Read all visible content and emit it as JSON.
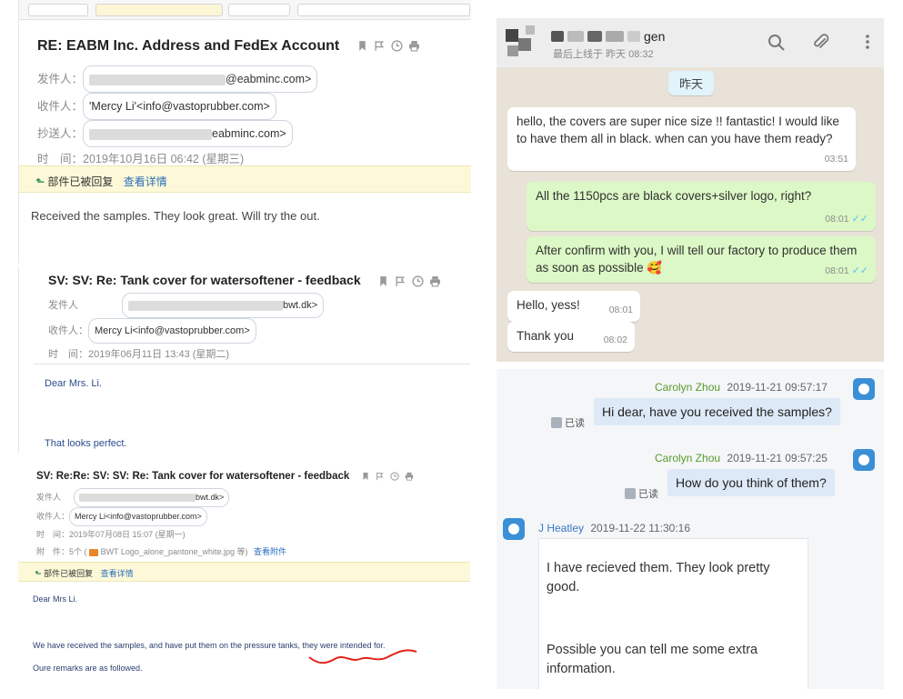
{
  "mail1": {
    "subject": "RE: EABM Inc. Address and FedEx Account",
    "from_label": "发件人：",
    "from_value": "@eabminc.com>",
    "to_label": "收件人：",
    "to_value": "'Mercy Li'<info@vastoprubber.com>",
    "cc_label": "抄送人：",
    "cc_value": "eabminc.com>",
    "time_label": "时　间：",
    "time_value": "2019年10月16日 06:42 (星期三)",
    "replied_text": "部件已被回复",
    "details_link": "查看详情",
    "body": "Received the samples.  They look great.  Will try the out."
  },
  "mail2": {
    "subject": "SV: SV: Re: Tank cover for watersoftener - feedback",
    "from_label": "发件人",
    "from_value": "bwt.dk>",
    "to_label": "收件人：",
    "to_value": "Mercy Li<info@vastoprubber.com>",
    "time_label": "时　间：",
    "time_value": "2019年06月11日 13:43 (星期二)",
    "greeting": "Dear Mrs. Li.",
    "body": "That looks perfect."
  },
  "mail3": {
    "subject": "SV: Re:Re: SV: SV: Re: Tank cover for watersoftener - feedback",
    "from_label": "发件人",
    "from_value": "bwt.dk>",
    "to_label": "收件人：",
    "to_value": "Mercy Li<info@vastoprubber.com>",
    "time_label": "时　间：",
    "time_value": "2019年07月08日 15:07 (星期一)",
    "attach_label": "附　件：",
    "attach_count": "5个 (",
    "attach_file": "BWT Logo_alone_pantone_white.jpg 等)",
    "attach_link": "查看附件",
    "replied_text": "部件已被回复",
    "details_link": "查看详情",
    "greeting": "Dear Mrs Li.",
    "body1": "We have received the samples, and have put them on the pressure tanks, they were intended for.",
    "body2": "Oure remarks are as followed."
  },
  "whatsapp": {
    "contact_suffix": "gen",
    "last_seen": "最后上线于 昨天 08:32",
    "date_chip": "昨天",
    "messages": [
      {
        "text": "hello, the covers are super nice size !! fantastic! I would like to have them all in black. when can you have them ready?",
        "time": "03:51"
      },
      {
        "text": "All the 1150pcs are black covers+silver logo, right?",
        "time": "08:01",
        "ticks": "✓✓"
      },
      {
        "text": "After confirm with you, I will tell our factory to produce them as soon as possible",
        "time": "08:01",
        "ticks": "✓✓",
        "emoji": "🥰"
      },
      {
        "text": "Hello, yess!",
        "time": "08:01"
      },
      {
        "text": "Thank you",
        "time": "08:02"
      }
    ]
  },
  "ali": {
    "messages": [
      {
        "name": "Carolyn Zhou",
        "time": "2019-11-21 09:57:17",
        "text": "Hi dear, have you received the samples?",
        "read": "已读"
      },
      {
        "name": "Carolyn Zhou",
        "time": "2019-11-21 09:57:25",
        "text": "How do you think of them?",
        "read": "已读"
      },
      {
        "name": "J Heatley",
        "time": "2019-11-22 11:30:16",
        "text1": "I have recieved them. They look pretty good.",
        "text2": "Possible you can tell me some extra information."
      }
    ]
  },
  "colors": {
    "wa_out": "#dcf8c6",
    "wa_bg": "#e9e2d8",
    "ali_bubble": "#dde9f7",
    "ali_name_green": "#5a9a2c",
    "ali_name_blue": "#3a78c2",
    "reply_bar": "#fdf9d8",
    "signature_red": "#e0241b"
  },
  "icons": [
    "bookmark-icon",
    "flag-icon",
    "clock-icon",
    "print-icon",
    "reply-arrow-icon",
    "search-icon",
    "paperclip-icon",
    "menu-icon",
    "double-check-icon",
    "read-icon",
    "avatar-icon",
    "image-file-icon"
  ]
}
